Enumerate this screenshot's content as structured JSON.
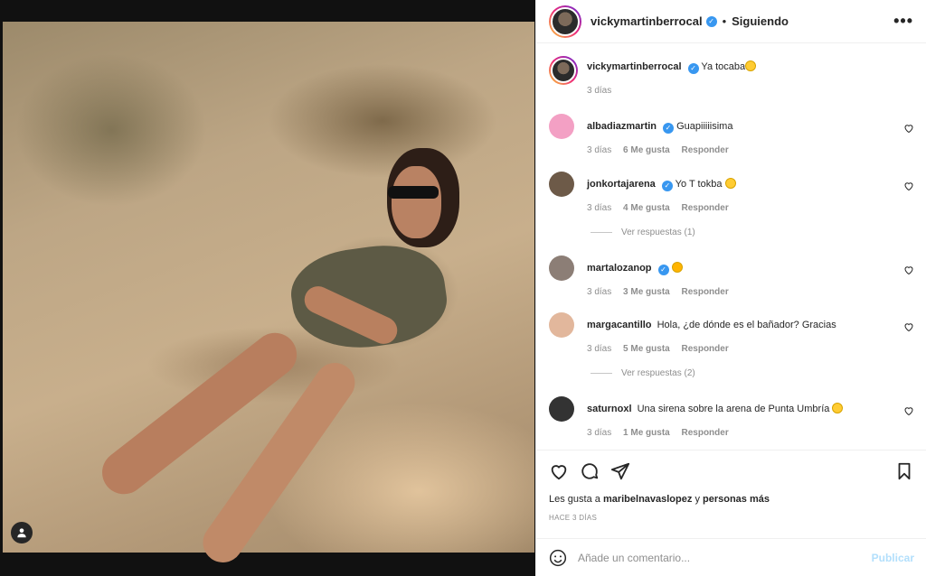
{
  "post": {
    "author": "vickymartinberrocal",
    "follow_status": "Siguiendo",
    "separator": "•",
    "more_icon": "•••"
  },
  "caption": {
    "user": "vickymartinberrocal",
    "text": "Ya tocaba",
    "time": "3 días"
  },
  "comments": [
    {
      "user": "albadiazmartin",
      "verified": true,
      "text": "Guapiiiiisima",
      "time": "3 días",
      "likes": "6 Me gusta",
      "reply": "Responder",
      "avatar_color": "#f3a0c4"
    },
    {
      "user": "jonkortajarena",
      "verified": true,
      "text": "Yo T tokba",
      "time": "3 días",
      "likes": "4 Me gusta",
      "reply": "Responder",
      "avatar_color": "#6d5a48",
      "view_replies": "Ver respuestas (1)"
    },
    {
      "user": "martalozanop",
      "verified": true,
      "text": "",
      "time": "3 días",
      "likes": "3 Me gusta",
      "reply": "Responder",
      "avatar_color": "#8c7e76"
    },
    {
      "user": "margacantillo",
      "verified": false,
      "text": "Hola, ¿de dónde es el bañador? Gracias",
      "time": "3 días",
      "likes": "5 Me gusta",
      "reply": "Responder",
      "avatar_color": "#e2b79c",
      "view_replies": "Ver respuestas (2)"
    },
    {
      "user": "saturnoxl",
      "verified": false,
      "text": "Una sirena sobre la arena de Punta Umbría",
      "time": "3 días",
      "likes": "1 Me gusta",
      "reply": "Responder",
      "avatar_color": "#333333"
    }
  ],
  "likes_line": {
    "prefix": "Les gusta a",
    "user": "maribelnavaslopez",
    "middle": "y",
    "others": "personas más"
  },
  "time_ago": "HACE 3 DÍAS",
  "comment_box": {
    "placeholder": "Añade un comentario...",
    "publish": "Publicar"
  },
  "colors": {
    "verified": "#3897f0",
    "publish_disabled": "#b2dffc"
  }
}
